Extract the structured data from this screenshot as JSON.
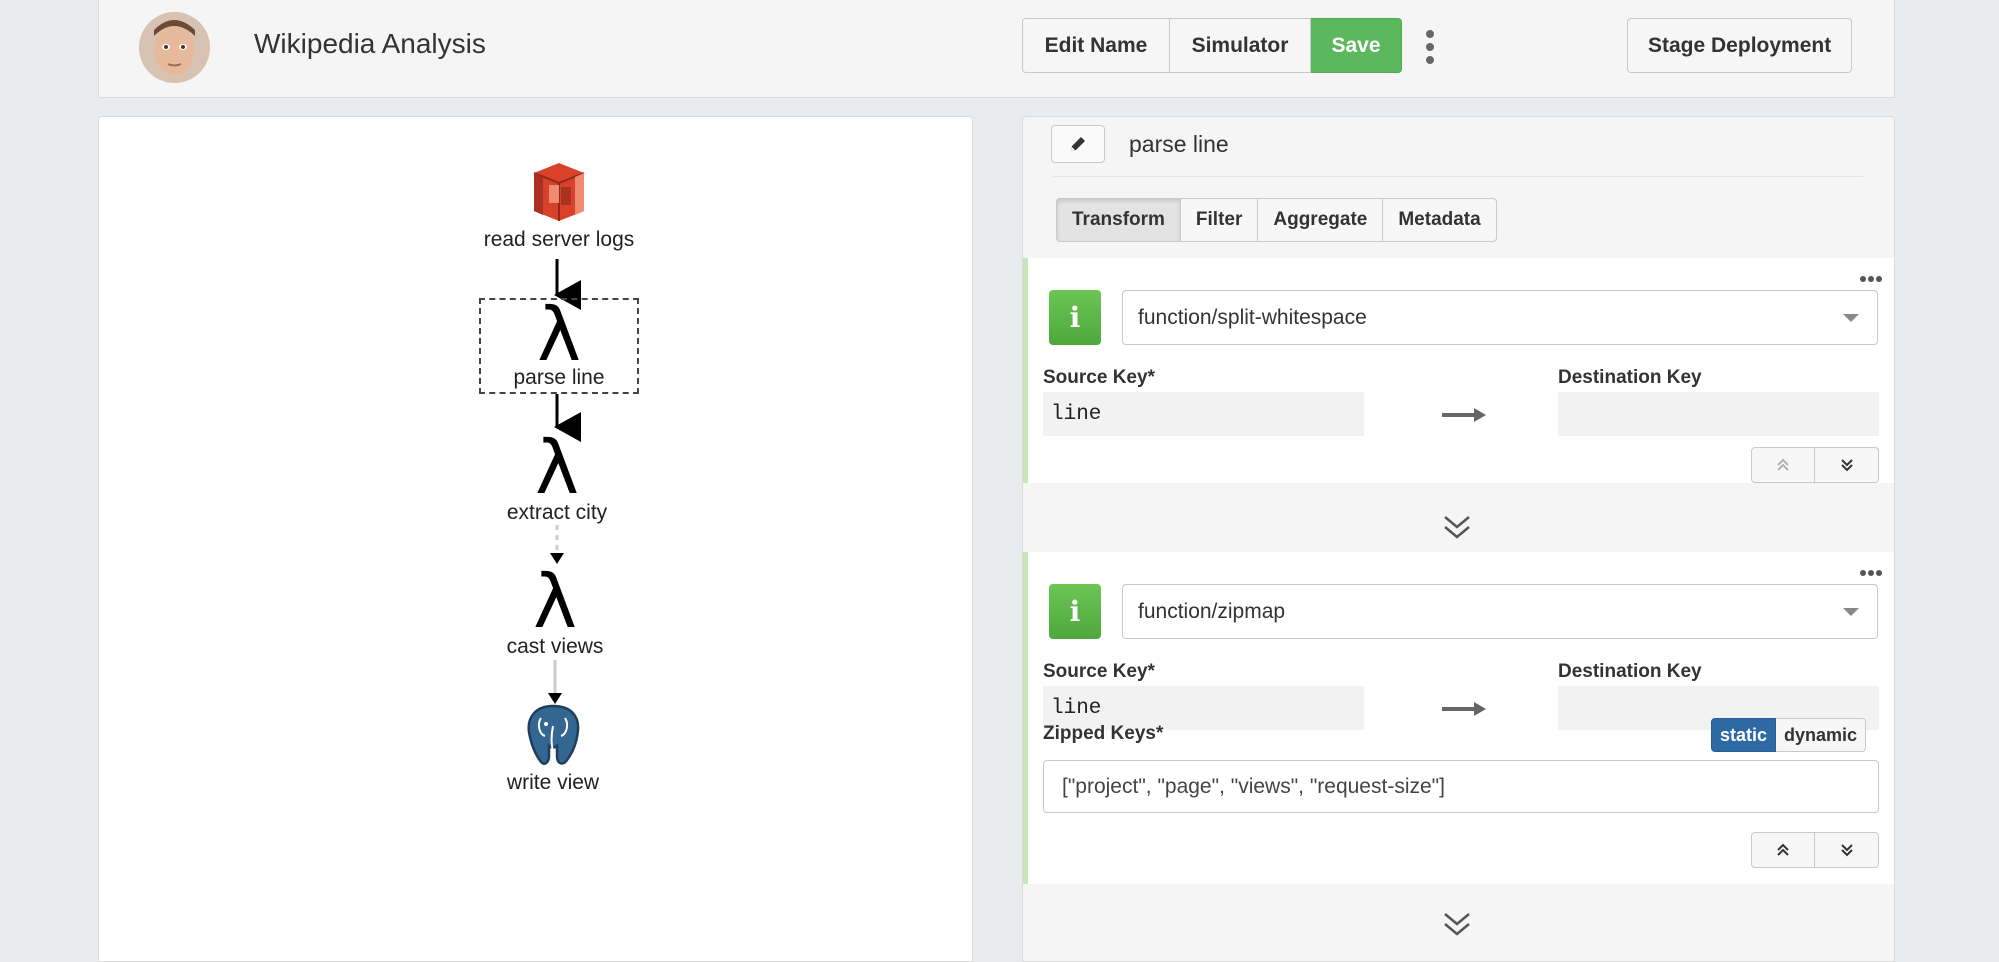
{
  "header": {
    "app_title": "Wikipedia Analysis",
    "buttons": {
      "edit_name": "Edit Name",
      "simulator": "Simulator",
      "save": "Save"
    },
    "stage_deployment": "Stage Deployment"
  },
  "pipeline": {
    "nodes": [
      {
        "label": "read server logs",
        "icon": "aws-s3-icon"
      },
      {
        "label": "parse line",
        "icon": "lambda-icon",
        "selected": true
      },
      {
        "label": "extract city",
        "icon": "lambda-icon"
      },
      {
        "label": "cast views",
        "icon": "lambda-icon"
      },
      {
        "label": "write view",
        "icon": "postgres-elephant-icon"
      }
    ]
  },
  "editor": {
    "stage_name": "parse line",
    "tabs": [
      "Transform",
      "Filter",
      "Aggregate",
      "Metadata"
    ],
    "transforms": [
      {
        "function": "function/split-whitespace",
        "source_key_label": "Source Key*",
        "source_key": "line",
        "destination_key_label": "Destination Key",
        "destination_key": ""
      },
      {
        "function": "function/zipmap",
        "source_key_label": "Source Key*",
        "source_key": "line",
        "destination_key_label": "Destination Key",
        "destination_key": "",
        "zipped_keys_label": "Zipped Keys*",
        "zipped_keys": "[\"project\", \"page\", \"views\", \"request-size\"]",
        "mode_options": [
          "static",
          "dynamic"
        ],
        "mode_selected": "static"
      }
    ]
  },
  "colors": {
    "save_green": "#5cb85c",
    "info_green": "#5cb85c",
    "static_blue": "#2d6aa3",
    "s3_red": "#d9412b",
    "postgres_blue": "#336791"
  }
}
